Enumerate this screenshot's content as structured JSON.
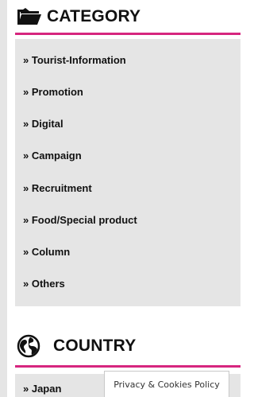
{
  "category": {
    "title": "CATEGORY",
    "icon": "folder-icon",
    "items": [
      "» Tourist-Information",
      "» Promotion",
      "» Digital",
      "» Campaign",
      "» Recruitment",
      "» Food/Special product",
      "» Column",
      "» Others"
    ]
  },
  "country": {
    "title": "COUNTRY",
    "icon": "globe-icon",
    "items": [
      "» Japan"
    ]
  },
  "privacy": {
    "label": "Privacy & Cookies Policy"
  },
  "colors": {
    "accent": "#d6267f",
    "panel_bg": "#e5e5e5",
    "text": "#111111"
  }
}
